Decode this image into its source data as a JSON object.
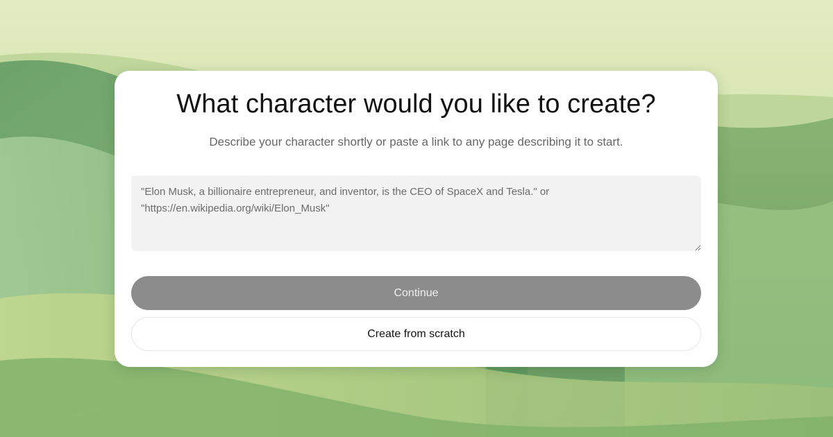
{
  "dialog": {
    "title": "What character would you like to create?",
    "subtitle": "Describe your character shortly or paste a link to any page describing it to start.",
    "description_input": {
      "value": "",
      "placeholder": "\"Elon Musk, a billionaire entrepreneur, and inventor, is the CEO of SpaceX and Tesla.\" or \"https://en.wikipedia.org/wiki/Elon_Musk\""
    },
    "continue_label": "Continue",
    "create_from_scratch_label": "Create from scratch"
  },
  "colors": {
    "continue_button_disabled": "#8c8c8c",
    "card_background": "#ffffff",
    "input_background": "#f2f2f2",
    "background_green": "#9fc07f"
  }
}
